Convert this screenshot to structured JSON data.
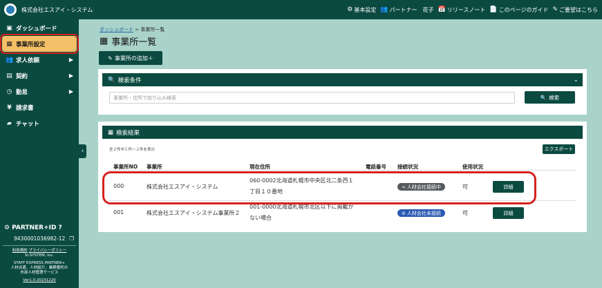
{
  "topbar": {
    "company": "株式会社エスアイ・システム",
    "items": [
      {
        "label": "基本設定",
        "icon": "gear-icon",
        "glyph": "⚙"
      },
      {
        "label": "パートナー　花子",
        "icon": "users-icon",
        "glyph": "👥"
      },
      {
        "label": "リリースノート",
        "icon": "calendar-icon",
        "glyph": "📅"
      },
      {
        "label": "このページのガイド",
        "icon": "document-icon",
        "glyph": "📄"
      },
      {
        "label": "ご要望はこちら",
        "icon": "edit-icon",
        "glyph": "✎"
      }
    ]
  },
  "sidebar": {
    "items": [
      {
        "label": "ダッシュボード",
        "icon": "dashboard-icon",
        "glyph": "▣"
      },
      {
        "label": "事業所設定",
        "icon": "building-icon",
        "glyph": "▦"
      },
      {
        "label": "求人依頼",
        "icon": "users-icon",
        "glyph": "👥"
      },
      {
        "label": "契約",
        "icon": "contract-icon",
        "glyph": "▤"
      },
      {
        "label": "勤怠",
        "icon": "clock-icon",
        "glyph": "◷"
      },
      {
        "label": "請求書",
        "icon": "yen-icon",
        "glyph": "¥"
      },
      {
        "label": "チャット",
        "icon": "chat-icon",
        "glyph": "▰"
      }
    ],
    "collapse_glyph": "‹",
    "partner_label": "PARTNER+ID",
    "partner_id": "9430001036982-12",
    "footer_links": [
      "利用規約",
      "プライバシーポリシー"
    ],
    "footer_company": "SI.SYSTEM, Inc.",
    "footer_product": "STAFF EXPRESS PARTNER+",
    "footer_desc1": "人材派遣、人材紹介、業務委託の",
    "footer_desc2": "外部人材管理サービス",
    "version": "Ver1.0.20231220"
  },
  "breadcrumb": {
    "root": "ダッシュボード",
    "sep": ">",
    "current": "事業所一覧"
  },
  "page": {
    "title": "事業所一覧",
    "add_button": "事業所の追加＋"
  },
  "search": {
    "header": "検索条件",
    "placeholder": "事業所・住所で絞り込み検索",
    "button": "検索"
  },
  "results": {
    "header": "検索結果",
    "count_text": "全２件中１件～２件を表示",
    "export_button": "エクスポート",
    "columns": [
      "事業所NO",
      "事業所",
      "現在住所",
      "電話番号",
      "接続状況",
      "使用状況"
    ],
    "rows": [
      {
        "no": "000",
        "name": "株式会社エスアイ・システム",
        "address1": "060-0002北海道札幌市中央区北二条西１",
        "address2": "丁目１０番地",
        "phone": "",
        "status": "人材会社接続中",
        "usage": "可",
        "detail": "詳細"
      },
      {
        "no": "001",
        "name": "株式会社エスアイ・システム事業所２",
        "address1": "001-0000北海道札幌市北区以下に掲載が",
        "address2": "ない場合",
        "phone": "",
        "status": "人材会社未接続",
        "usage": "可",
        "detail": "詳細"
      }
    ]
  }
}
